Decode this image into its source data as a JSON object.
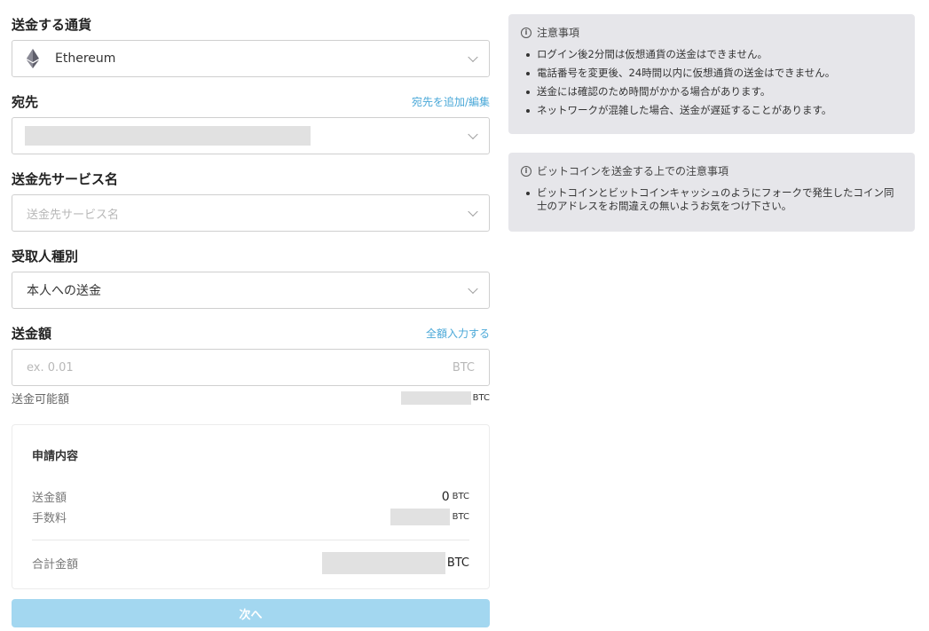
{
  "form": {
    "currency": {
      "label": "送金する通貨",
      "value": "Ethereum",
      "icon": "ethereum-icon"
    },
    "destination": {
      "label": "宛先",
      "link": "宛先を追加/編集"
    },
    "service": {
      "label": "送金先サービス名",
      "placeholder": "送金先サービス名"
    },
    "recipient_type": {
      "label": "受取人種別",
      "value": "本人への送金"
    },
    "amount": {
      "label": "送金額",
      "link": "全額入力する",
      "placeholder": "ex. 0.01",
      "unit": "BTC",
      "available_label": "送金可能額",
      "available_unit": "BTC"
    }
  },
  "summary": {
    "title": "申請内容",
    "amount_label": "送金額",
    "amount_value": "0",
    "amount_unit": "BTC",
    "fee_label": "手数料",
    "fee_unit": "BTC",
    "total_label": "合計金額",
    "total_unit": "BTC"
  },
  "next_button": "次へ",
  "notices": [
    {
      "title": "注意事項",
      "items": [
        "ログイン後2分間は仮想通貨の送金はできません。",
        "電話番号を変更後、24時間以内に仮想通貨の送金はできません。",
        "送金には確認のため時間がかかる場合があります。",
        "ネットワークが混雑した場合、送金が遅延することがあります。"
      ]
    },
    {
      "title": "ビットコインを送金する上での注意事項",
      "items": [
        "ビットコインとビットコインキャッシュのようにフォークで発生したコイン同士のアドレスをお間違えの無いようお気をつけ下さい。"
      ]
    }
  ],
  "colors": {
    "accent": "#4aa8d8",
    "button": "#a3d7f0",
    "notice_bg": "#e6e6ea",
    "redacted": "#e1e1e1"
  }
}
